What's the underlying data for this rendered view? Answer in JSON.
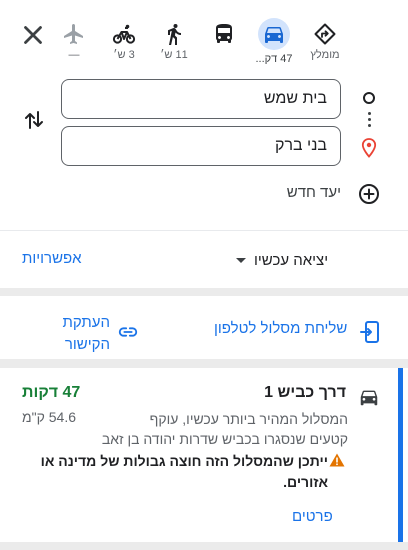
{
  "modes": {
    "recommended": {
      "icon": "diamond-turn-icon",
      "label": "מומלץ"
    },
    "driving": {
      "icon": "car-icon",
      "label": "47 דק...",
      "selected": true
    },
    "transit": {
      "icon": "bus-icon",
      "label": ""
    },
    "walking": {
      "icon": "walk-icon",
      "label": "11 ש׳"
    },
    "cycling": {
      "icon": "bicycle-icon",
      "label": "3 ש׳"
    },
    "flight": {
      "icon": "airplane-icon",
      "label": "—"
    }
  },
  "directions": {
    "origin": "בית שמש",
    "destination": "בני ברק",
    "add_destination": "יעד חדש"
  },
  "options_row": {
    "depart": "יציאה עכשיו",
    "options": "אפשרויות"
  },
  "share_row": {
    "send_to_phone": "שליחת מסלול לטלפון",
    "copy_link": "העתקת הקישור"
  },
  "route": {
    "name": "דרך כביש 1",
    "duration": "47 דקות",
    "description": "המסלול המהיר ביותר עכשיו, עוקף",
    "distance": "54.6 ק\"מ",
    "description2": "קטעים שנסגרו בכביש שדרות יהודה בן זאב",
    "warning": "ייתכן שהמסלול הזה חוצה גבולות של מדינה או אזורים.",
    "details": "פרטים"
  },
  "colors": {
    "accent": "#1a73e8",
    "duration": "#188038",
    "selected_mode_bg": "#d2e3fc",
    "warning": "#e37400",
    "pin": "#ea4335"
  }
}
